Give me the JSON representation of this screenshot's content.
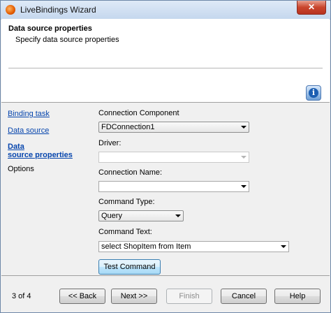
{
  "window": {
    "title": "LiveBindings Wizard",
    "close_glyph": "✕"
  },
  "header": {
    "title": "Data source properties",
    "subtitle": "Specify data source properties",
    "info_glyph": "i"
  },
  "nav": {
    "items": [
      {
        "label": "Binding task"
      },
      {
        "label": "Data source"
      },
      {
        "label_line1": "Data",
        "label_line2": "source properties"
      },
      {
        "label": "Options"
      }
    ]
  },
  "form": {
    "connection_component": {
      "label": "Connection Component",
      "value": "FDConnection1"
    },
    "driver": {
      "label": "Driver:",
      "value": ""
    },
    "connection_name": {
      "label": "Connection Name:",
      "value": ""
    },
    "command_type": {
      "label": "Command Type:",
      "value": "Query"
    },
    "command_text": {
      "label": "Command Text:",
      "value": "select ShopItem from Item"
    },
    "test_button": "Test Command"
  },
  "footer": {
    "page_count": "3 of 4",
    "back": "<< Back",
    "next": "Next >>",
    "finish": "Finish",
    "cancel": "Cancel",
    "help": "Help"
  }
}
